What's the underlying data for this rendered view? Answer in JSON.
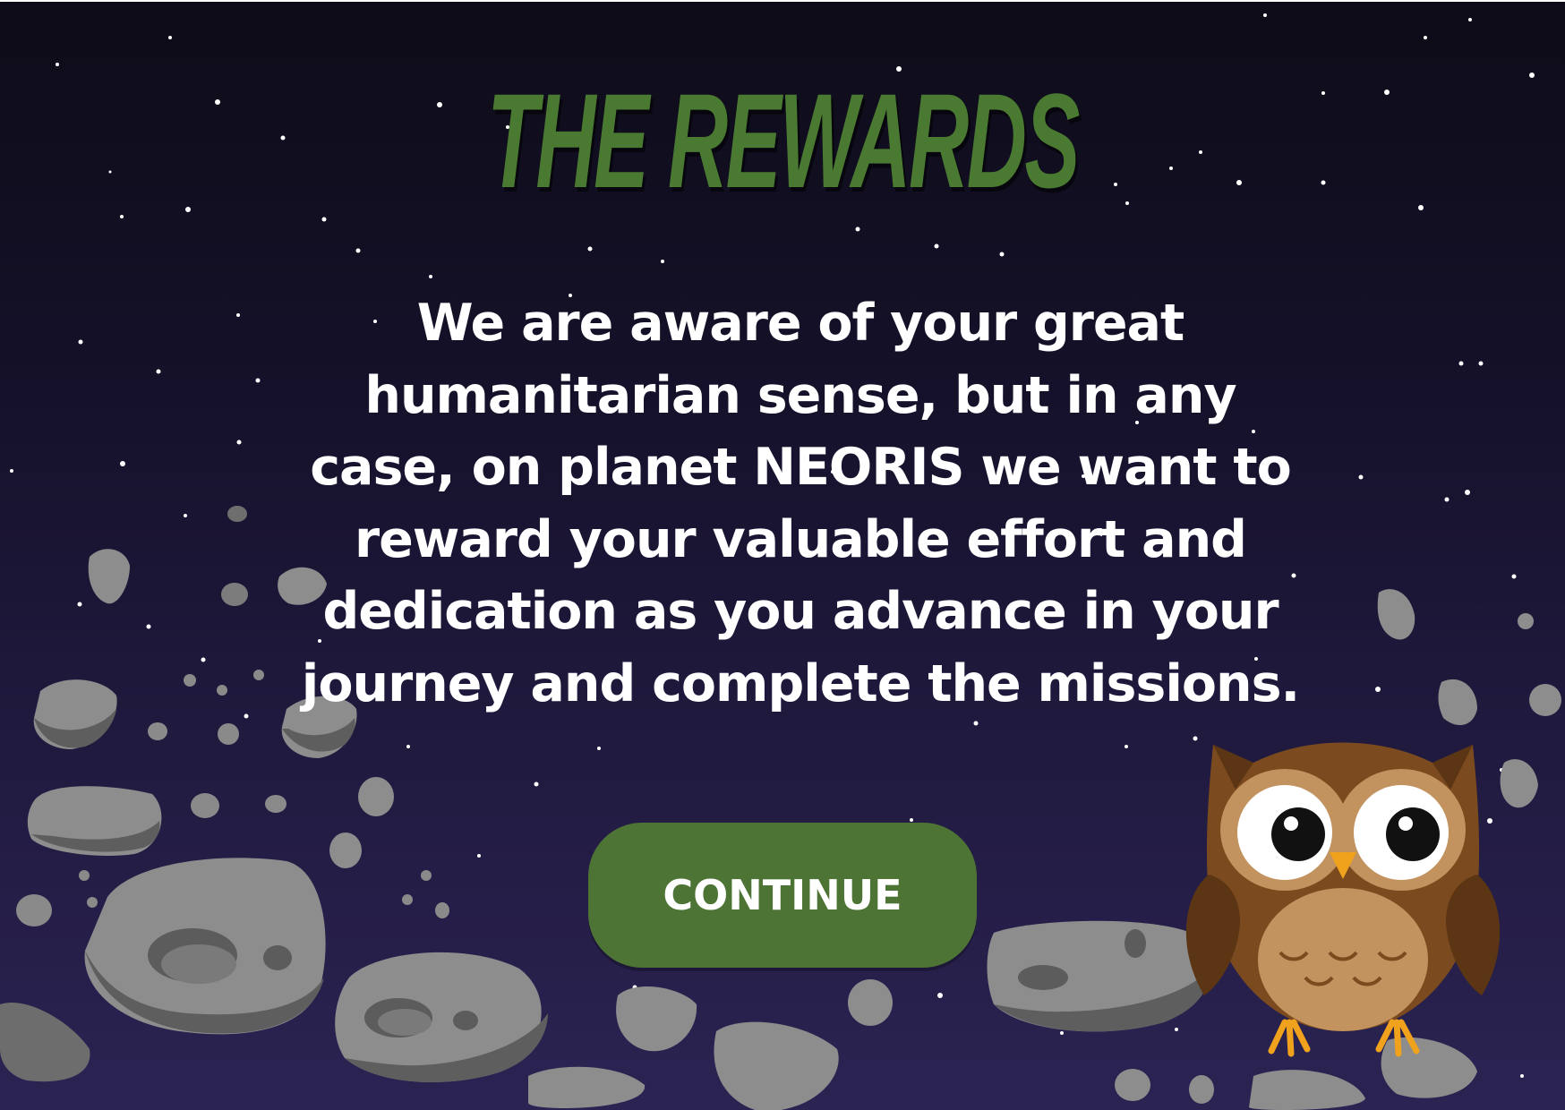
{
  "screen": {
    "title": "THE REWARDS",
    "message": "We are aware of your great humanitarian sense, but in any case, on planet NEORIS we want to reward your valuable effort and dedication as you advance in your journey and complete the missions.",
    "continue_label": "CONTINUE"
  },
  "theme": {
    "background_top": "#0e0c18",
    "background_bottom": "#2b2352",
    "title_color": "#4a7a31",
    "button_color": "#4e7435",
    "text_color": "#ffffff",
    "rock_color": "#8a8a8a"
  },
  "decorations": {
    "mascot": "owl",
    "scenery": "asteroid-field",
    "backdrop": "starry-space"
  }
}
